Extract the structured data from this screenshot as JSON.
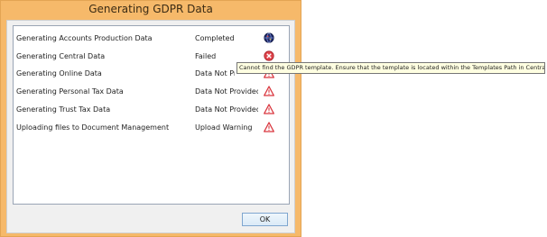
{
  "window": {
    "title": "Generating GDPR Data"
  },
  "rows": [
    {
      "task": "Generating Accounts Production Data",
      "status": "Completed",
      "icon": "completed-globe-icon"
    },
    {
      "task": "Generating Central Data",
      "status": "Failed",
      "icon": "error-circle-icon"
    },
    {
      "task": "Generating Online Data",
      "status": "Data Not Provided",
      "icon": "warning-triangle-icon"
    },
    {
      "task": "Generating Personal Tax Data",
      "status": "Data Not Provided",
      "icon": "warning-triangle-icon"
    },
    {
      "task": "Generating Trust Tax Data",
      "status": "Data Not Provided",
      "icon": "warning-triangle-icon"
    },
    {
      "task": "Uploading files to Document Management",
      "status": "Upload Warning",
      "icon": "warning-triangle-icon"
    }
  ],
  "tooltip": {
    "text": "Cannot find the GDPR template. Ensure that the template is located within the Templates Path in Central."
  },
  "buttons": {
    "ok_label": "OK"
  },
  "colors": {
    "frame": "#f6b96a",
    "error": "#d9363e",
    "warning": "#d9363e",
    "tooltip_bg": "#ffffe1"
  }
}
